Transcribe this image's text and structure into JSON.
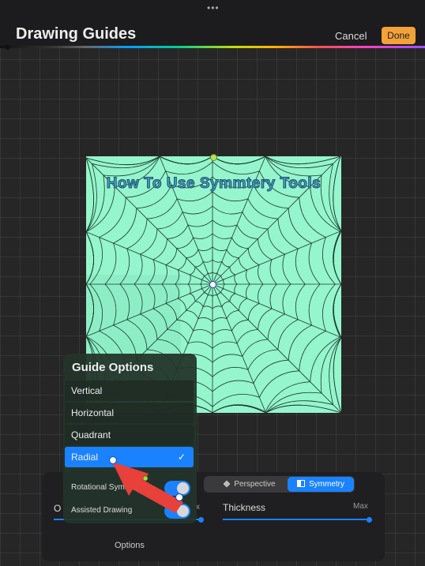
{
  "app": {
    "title": "Drawing Guides",
    "grabber": "•••",
    "cancel_label": "Cancel",
    "done_label": "Done"
  },
  "canvas": {
    "overlay_text": "How To Use Symmtery Tools",
    "background_color": "#95f5cc"
  },
  "guide_options": {
    "title": "Guide Options",
    "items": [
      {
        "label": "Vertical",
        "selected": false
      },
      {
        "label": "Horizontal",
        "selected": false
      },
      {
        "label": "Quadrant",
        "selected": false
      },
      {
        "label": "Radial",
        "selected": true
      }
    ],
    "check_mark": "✓",
    "toggles": [
      {
        "label": "Rotational Symmetry",
        "on": true
      },
      {
        "label": "Assisted Drawing",
        "on": true
      }
    ]
  },
  "bottom_panel": {
    "tabs": [
      {
        "label": "Perspective",
        "icon": "cube-icon",
        "active": false
      },
      {
        "label": "Symmetry",
        "icon": "symmetry-icon",
        "active": true
      }
    ],
    "left_slider_label": "O",
    "left_slider_max": "x",
    "thickness_label": "Thickness",
    "thickness_max": "Max",
    "options_label": "Options"
  },
  "colors": {
    "accent": "#1a82ff",
    "done_button": "#f3a23a",
    "arrow": "#e8403a"
  }
}
